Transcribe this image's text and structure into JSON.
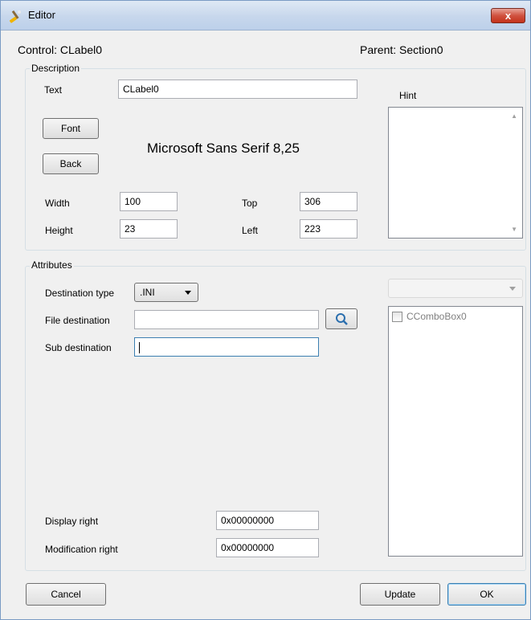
{
  "window": {
    "title": "Editor",
    "close_label": "x"
  },
  "header": {
    "control": "Control: CLabel0",
    "parent": "Parent: Section0"
  },
  "description": {
    "group_title": "Description",
    "text_label": "Text",
    "text_value": "CLabel0",
    "font_button": "Font",
    "back_button": "Back",
    "font_display": "Microsoft Sans Serif 8,25",
    "width_label": "Width",
    "width_value": "100",
    "height_label": "Height",
    "height_value": "23",
    "top_label": "Top",
    "top_value": "306",
    "left_label": "Left",
    "left_value": "223",
    "hint_label": "Hint",
    "hint_value": ""
  },
  "attributes": {
    "group_title": "Attributes",
    "destination_type_label": "Destination type",
    "destination_type_value": ".INI",
    "file_destination_label": "File destination",
    "file_destination_value": "",
    "sub_destination_label": "Sub destination",
    "sub_destination_value": "",
    "display_right_label": "Display right",
    "display_right_value": "0x00000000",
    "modification_right_label": "Modification right",
    "modification_right_value": "0x00000000",
    "side_combo_value": "",
    "check_items": [
      {
        "label": "CComboBox0",
        "checked": false
      }
    ]
  },
  "footer": {
    "cancel": "Cancel",
    "update": "Update",
    "ok": "OK"
  },
  "icons": {
    "window": "editor-brush-icon",
    "search": "magnifier-icon"
  },
  "colors": {
    "titlebar": "#c7d7ec",
    "close": "#c4321c",
    "background": "#f0f0f0",
    "focus": "#3c7fb1"
  }
}
